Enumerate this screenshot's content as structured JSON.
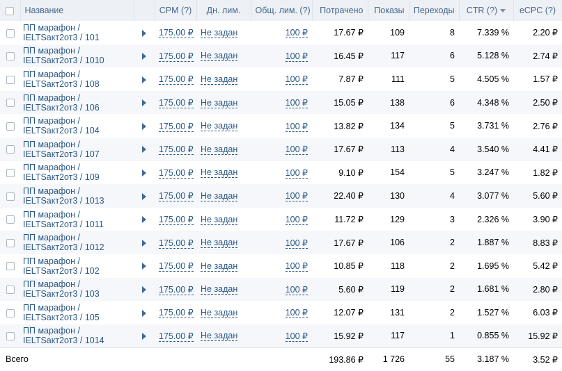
{
  "header": {
    "name": "Название",
    "cpm": "CPM (?)",
    "day_limit": "Дн. лим.",
    "total_limit": "Общ. лим. (?)",
    "spent": "Потрачено",
    "impressions": "Показы",
    "clicks": "Переходы",
    "ctr": "CTR (?)",
    "ecpc": "eCPC (?)"
  },
  "rows": [
    {
      "name": "ПП марафон / IELTSакт2от3 / 101",
      "cpm": "175.00 ₽",
      "day_limit": "Не задан",
      "total_limit": "100 ₽",
      "spent": "17.67 ₽",
      "impressions": "109",
      "clicks": "8",
      "ctr": "7.339 %",
      "ecpc": "2.20 ₽"
    },
    {
      "name": "ПП марафон / IELTSакт2от3 / 1010",
      "cpm": "175.00 ₽",
      "day_limit": "Не задан",
      "total_limit": "100 ₽",
      "spent": "16.45 ₽",
      "impressions": "117",
      "clicks": "6",
      "ctr": "5.128 %",
      "ecpc": "2.74 ₽"
    },
    {
      "name": "ПП марафон / IELTSакт2от3 / 108",
      "cpm": "175.00 ₽",
      "day_limit": "Не задан",
      "total_limit": "100 ₽",
      "spent": "7.87 ₽",
      "impressions": "111",
      "clicks": "5",
      "ctr": "4.505 %",
      "ecpc": "1.57 ₽"
    },
    {
      "name": "ПП марафон / IELTSакт2от3 / 106",
      "cpm": "175.00 ₽",
      "day_limit": "Не задан",
      "total_limit": "100 ₽",
      "spent": "15.05 ₽",
      "impressions": "138",
      "clicks": "6",
      "ctr": "4.348 %",
      "ecpc": "2.50 ₽"
    },
    {
      "name": "ПП марафон / IELTSакт2от3 / 104",
      "cpm": "175.00 ₽",
      "day_limit": "Не задан",
      "total_limit": "100 ₽",
      "spent": "13.82 ₽",
      "impressions": "134",
      "clicks": "5",
      "ctr": "3.731 %",
      "ecpc": "2.76 ₽"
    },
    {
      "name": "ПП марафон / IELTSакт2от3 / 107",
      "cpm": "175.00 ₽",
      "day_limit": "Не задан",
      "total_limit": "100 ₽",
      "spent": "17.67 ₽",
      "impressions": "113",
      "clicks": "4",
      "ctr": "3.540 %",
      "ecpc": "4.41 ₽"
    },
    {
      "name": "ПП марафон / IELTSакт2от3 / 109",
      "cpm": "175.00 ₽",
      "day_limit": "Не задан",
      "total_limit": "100 ₽",
      "spent": "9.10 ₽",
      "impressions": "154",
      "clicks": "5",
      "ctr": "3.247 %",
      "ecpc": "1.82 ₽"
    },
    {
      "name": "ПП марафон / IELTSакт2от3 / 1013",
      "cpm": "175.00 ₽",
      "day_limit": "Не задан",
      "total_limit": "100 ₽",
      "spent": "22.40 ₽",
      "impressions": "130",
      "clicks": "4",
      "ctr": "3.077 %",
      "ecpc": "5.60 ₽"
    },
    {
      "name": "ПП марафон / IELTSакт2от3 / 1011",
      "cpm": "175.00 ₽",
      "day_limit": "Не задан",
      "total_limit": "100 ₽",
      "spent": "11.72 ₽",
      "impressions": "129",
      "clicks": "3",
      "ctr": "2.326 %",
      "ecpc": "3.90 ₽"
    },
    {
      "name": "ПП марафон / IELTSакт2от3 / 1012",
      "cpm": "175.00 ₽",
      "day_limit": "Не задан",
      "total_limit": "100 ₽",
      "spent": "17.67 ₽",
      "impressions": "106",
      "clicks": "2",
      "ctr": "1.887 %",
      "ecpc": "8.83 ₽"
    },
    {
      "name": "ПП марафон / IELTSакт2от3 / 102",
      "cpm": "175.00 ₽",
      "day_limit": "Не задан",
      "total_limit": "100 ₽",
      "spent": "10.85 ₽",
      "impressions": "118",
      "clicks": "2",
      "ctr": "1.695 %",
      "ecpc": "5.42 ₽"
    },
    {
      "name": "ПП марафон / IELTSакт2от3 / 103",
      "cpm": "175.00 ₽",
      "day_limit": "Не задан",
      "total_limit": "100 ₽",
      "spent": "5.60 ₽",
      "impressions": "119",
      "clicks": "2",
      "ctr": "1.681 %",
      "ecpc": "2.80 ₽"
    },
    {
      "name": "ПП марафон / IELTSакт2от3 / 105",
      "cpm": "175.00 ₽",
      "day_limit": "Не задан",
      "total_limit": "100 ₽",
      "spent": "12.07 ₽",
      "impressions": "131",
      "clicks": "2",
      "ctr": "1.527 %",
      "ecpc": "6.03 ₽"
    },
    {
      "name": "ПП марафон / IELTSакт2от3 / 1014",
      "cpm": "175.00 ₽",
      "day_limit": "Не задан",
      "total_limit": "100 ₽",
      "spent": "15.92 ₽",
      "impressions": "117",
      "clicks": "1",
      "ctr": "0.855 %",
      "ecpc": "15.92 ₽"
    }
  ],
  "totals": {
    "label": "Всего",
    "spent": "193.86 ₽",
    "impressions": "1 726",
    "clicks": "55",
    "ctr": "3.187 %",
    "ecpc": "3.52 ₽"
  },
  "icons": {
    "row_expand": "play-triangle-icon",
    "sort": "sort-desc-icon"
  },
  "colors": {
    "link": "#2a5885",
    "header_bg": "#edf0f5",
    "header_text": "#45678f"
  }
}
